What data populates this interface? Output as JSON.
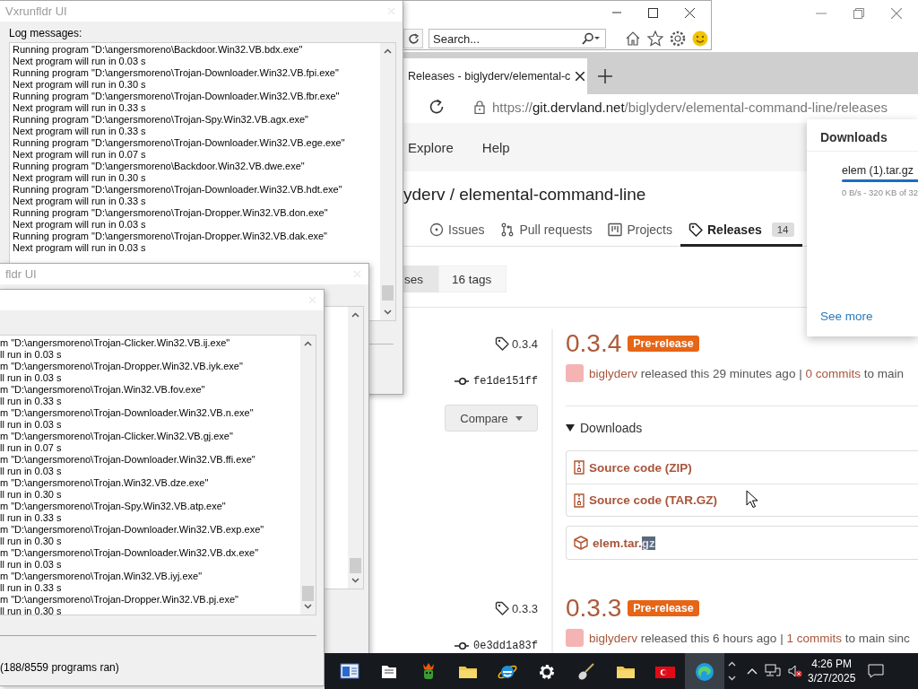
{
  "log_windows": [
    {
      "title": "Vxrunfldr UI",
      "label": "Log messages:",
      "lines": [
        "Running program \"D:\\angersmoreno\\Backdoor.Win32.VB.bdx.exe\"",
        "Next program will run in 0.03 s",
        "Running program \"D:\\angersmoreno\\Trojan-Downloader.Win32.VB.fpi.exe\"",
        "Next program will run in 0.30 s",
        "Running program \"D:\\angersmoreno\\Trojan-Downloader.Win32.VB.fbr.exe\"",
        "Next program will run in 0.33 s",
        "Running program \"D:\\angersmoreno\\Trojan-Spy.Win32.VB.agx.exe\"",
        "Next program will run in 0.33 s",
        "Running program \"D:\\angersmoreno\\Trojan-Downloader.Win32.VB.ege.exe\"",
        "Next program will run in 0.07 s",
        "Running program \"D:\\angersmoreno\\Backdoor.Win32.VB.dwe.exe\"",
        "Next program will run in 0.30 s",
        "Running program \"D:\\angersmoreno\\Trojan-Downloader.Win32.VB.hdt.exe\"",
        "Next program will run in 0.33 s",
        "Running program \"D:\\angersmoreno\\Trojan-Dropper.Win32.VB.don.exe\"",
        "Next program will run in 0.03 s",
        "Running program \"D:\\angersmoreno\\Trojan-Dropper.Win32.VB.dak.exe\"",
        "Next program will run in 0.03 s"
      ]
    },
    {
      "title": "fldr UI"
    },
    {
      "lines": [
        "m \"D:\\angersmoreno\\Trojan-Clicker.Win32.VB.ij.exe\"",
        "ll run in 0.03 s",
        "m \"D:\\angersmoreno\\Trojan-Dropper.Win32.VB.iyk.exe\"",
        "ll run in 0.03 s",
        "m \"D:\\angersmoreno\\Trojan.Win32.VB.fov.exe\"",
        "ll run in 0.33 s",
        "m \"D:\\angersmoreno\\Trojan-Downloader.Win32.VB.n.exe\"",
        "ll run in 0.03 s",
        "m \"D:\\angersmoreno\\Trojan-Clicker.Win32.VB.gj.exe\"",
        "ll run in 0.07 s",
        "m \"D:\\angersmoreno\\Trojan-Downloader.Win32.VB.ffi.exe\"",
        "ll run in 0.03 s",
        "m \"D:\\angersmoreno\\Trojan.Win32.VB.dze.exe\"",
        "ll run in 0.30 s",
        "m \"D:\\angersmoreno\\Trojan-Spy.Win32.VB.atp.exe\"",
        "ll run in 0.33 s",
        "m \"D:\\angersmoreno\\Trojan-Downloader.Win32.VB.exp.exe\"",
        "ll run in 0.30 s",
        "m \"D:\\angersmoreno\\Trojan-Downloader.Win32.VB.dx.exe\"",
        "ll run in 0.03 s",
        "m \"D:\\angersmoreno\\Trojan.Win32.VB.iyj.exe\"",
        "ll run in 0.33 s",
        "m \"D:\\angersmoreno\\Trojan-Dropper.Win32.VB.pj.exe\"",
        "ll run in 0.30 s"
      ],
      "status": "(188/8559 programs ran)"
    }
  ],
  "ie_window": {
    "search": {
      "placeholder": "Search..."
    }
  },
  "browser": {
    "tab": {
      "title": "Releases - biglyderv/elemental-c",
      "selected": true
    },
    "url": {
      "host": "https://git.dervland.net",
      "path": "/biglyderv/elemental-command-line/releases"
    },
    "nav": [
      "Explore",
      "Help"
    ],
    "repo_title": "yderv / elemental-command-line",
    "repo_tabs": [
      {
        "kind": "issues",
        "label": "Issues",
        "selected": false
      },
      {
        "kind": "pulls",
        "label": "Pull requests",
        "selected": false
      },
      {
        "kind": "projects",
        "label": "Projects",
        "selected": false
      },
      {
        "kind": "releases",
        "label": "Releases",
        "count": "14",
        "selected": true
      }
    ],
    "release_switch": [
      {
        "label": "ses",
        "selected": true
      },
      {
        "label": "16 tags",
        "selected": false
      }
    ],
    "releases": [
      {
        "tag": "0.3.4",
        "commit": "fe1de151ff",
        "compare": "Compare",
        "version": "0.3.4",
        "badge": "Pre-release",
        "author": "biglyderv",
        "released": "released this 29 minutes ago |",
        "commits": "0 commits",
        "tail": "to main",
        "downloads": {
          "label": "Downloads",
          "expanded": true,
          "sources": [
            "Source code (ZIP)",
            "Source code (TAR.GZ)"
          ],
          "assets": [
            {
              "parts": [
                {
                  "text": "elem.tar.",
                  "selected": false
                },
                {
                  "text": "gz",
                  "selected": true
                }
              ]
            }
          ]
        }
      },
      {
        "tag": "0.3.3",
        "commit": "0e3dd1a83f",
        "version": "0.3.3",
        "badge": "Pre-release",
        "author": "biglyderv",
        "released": "released this 6 hours ago |",
        "commits": "1 commits",
        "tail": "to main sinc"
      }
    ],
    "downloads_panel": {
      "title": "Downloads",
      "file": "elem (1).tar.gz",
      "level": 1,
      "detail": "0 B/s - 320 KB of 32",
      "link": "See more"
    }
  },
  "taskbar": {
    "apps": [
      {
        "kind": "window",
        "active": false
      },
      {
        "kind": "file",
        "active": false
      },
      {
        "kind": "creature",
        "active": false
      },
      {
        "kind": "folder",
        "active": false
      },
      {
        "kind": "ie",
        "active": false
      },
      {
        "kind": "gear",
        "active": false
      },
      {
        "kind": "guitar",
        "active": false
      },
      {
        "kind": "folder",
        "active": false
      },
      {
        "kind": "flag",
        "active": false
      },
      {
        "kind": "edge",
        "active": true
      }
    ],
    "time": "4:26 PM",
    "date": "3/27/2025"
  }
}
